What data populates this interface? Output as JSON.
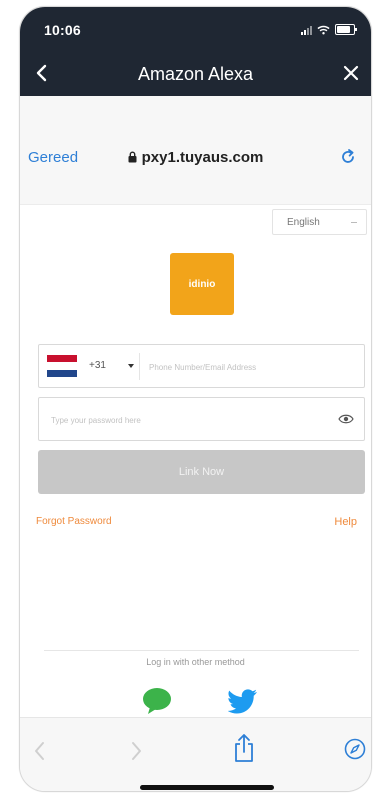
{
  "status_bar": {
    "time": "10:06"
  },
  "navbar": {
    "title": "Amazon Alexa"
  },
  "url_bar": {
    "done_label": "Gereed",
    "domain": "pxy1.tuyaus.com"
  },
  "login": {
    "language": "English",
    "logo_text": "idinio",
    "country_code": "+31",
    "phone_placeholder": "Phone Number/Email Address",
    "password_placeholder": "Type your password here",
    "link_button": "Link Now",
    "forgot_password": "Forgot Password",
    "help": "Help",
    "other_method": "Log in with other method"
  },
  "colors": {
    "accent_blue": "#2e7fd6",
    "orange_link": "#ef8a3c",
    "logo_bg": "#f2a41a",
    "dark_header": "#1f2733",
    "button_disabled": "#c7c7c7"
  },
  "icons": {
    "back": "chevron-left-icon",
    "close": "close-icon",
    "lock": "lock-icon",
    "reload": "reload-icon",
    "eye": "eye-icon",
    "wechat": "wechat-icon",
    "twitter": "twitter-icon",
    "share": "share-icon",
    "compass": "compass-icon"
  }
}
